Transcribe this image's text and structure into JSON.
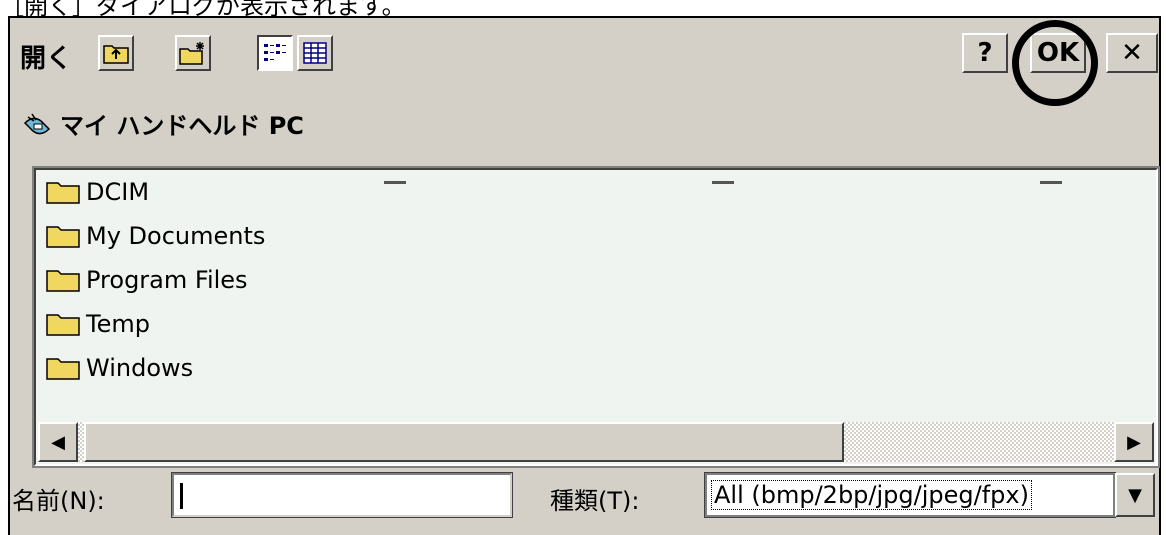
{
  "caption": "［開く］ダイアログが表示されます。",
  "dialog": {
    "title": "開く",
    "toolbar": [
      {
        "name": "up-folder-button",
        "icon": "up-folder-icon"
      },
      {
        "name": "new-folder-button",
        "icon": "new-folder-icon"
      },
      {
        "name": "list-view-button",
        "icon": "list-view-icon",
        "pressed": true
      },
      {
        "name": "details-view-button",
        "icon": "details-view-icon",
        "pressed": false
      }
    ],
    "help_label": "?",
    "ok_label": "OK",
    "close_label": "✕",
    "location": "マイ ハンドヘルド PC",
    "location_icon": "handheld-pc-icon"
  },
  "files": [
    {
      "name": "DCIM",
      "icon": "folder-icon"
    },
    {
      "name": "My Documents",
      "icon": "folder-icon"
    },
    {
      "name": "Program Files",
      "icon": "folder-icon"
    },
    {
      "name": "Temp",
      "icon": "folder-icon"
    },
    {
      "name": "Windows",
      "icon": "folder-icon"
    }
  ],
  "scrollbar": {
    "left_arrow": "◀",
    "right_arrow": "▶"
  },
  "name_field": {
    "label": "名前(N):",
    "value": ""
  },
  "type_field": {
    "label": "種類(T):",
    "value": "All (bmp/2bp/jpg/jpeg/fpx)",
    "dropdown": "▼"
  },
  "colors": {
    "face": "#d4d0c8",
    "list_bg": "#f0f4f0",
    "folder": "#f0d860"
  }
}
